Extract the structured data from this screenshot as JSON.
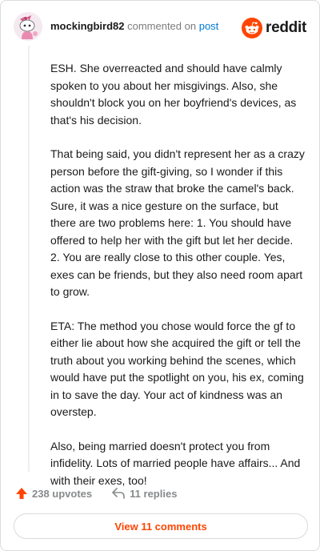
{
  "comment": {
    "username": "mockingbird82",
    "action_text": "commented on",
    "post_link": "post",
    "brand": "reddit",
    "paragraphs": [
      "ESH. She overreacted and should have calmly spoken to you about her misgivings. Also, she shouldn't block you on her boyfriend's devices, as that's his decision.",
      "That being said, you didn't represent her as a crazy person before the gift-giving, so I wonder if this action was the straw that broke the camel's back. Sure, it was a nice gesture on the surface, but there are two problems here: 1. You should have offered to help her with the gift but let her decide. 2. You are really close to this other couple. Yes, exes can be friends, but they also need room apart to grow.",
      "ETA: The method you chose would force the gf to either lie about how she acquired the gift or tell the truth about you working behind the scenes, which would have put the spotlight on you, his ex, coming in to save the day. Your act of kindness was an overstep.",
      "Also, being married doesn't protect you from infidelity. Lots of married people have affairs... And with their exes, too!"
    ]
  },
  "footer": {
    "upvotes": "238 upvotes",
    "replies": "11 replies",
    "view_button": "View 11 comments"
  },
  "colors": {
    "accent": "#ff4500",
    "link": "#0079d3",
    "muted": "#878a8c"
  },
  "icons": {
    "avatar": "snoo-avatar",
    "brand": "reddit-logo-icon",
    "upvote": "upvote-arrow-icon",
    "reply": "reply-icon"
  }
}
